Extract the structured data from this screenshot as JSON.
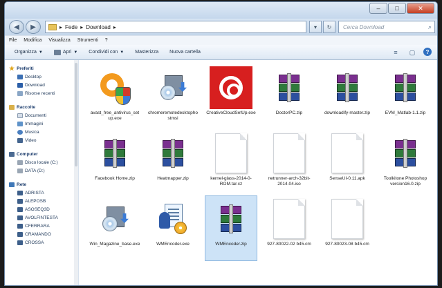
{
  "window": {
    "controls": {
      "minimize": "–",
      "maximize": "□",
      "close": "✕"
    }
  },
  "address": {
    "segments": [
      "Fede",
      "Download"
    ],
    "separators": [
      "▸",
      "▸",
      "▸"
    ],
    "back_icon": "◀",
    "forward_icon": "▶",
    "dropdown_icon": "▾",
    "refresh_icon": "↻",
    "search_placeholder": "Cerca Download",
    "search_icon": "magnifier"
  },
  "menu": [
    "File",
    "Modifica",
    "Visualizza",
    "Strumenti",
    "?"
  ],
  "toolbar": {
    "organize": "Organizza",
    "open": "Apri",
    "share": "Condividi con",
    "burn": "Masterizza",
    "new_folder": "Nuova cartella",
    "view_icon": "≡",
    "preview_icon": "▢",
    "help_icon": "?"
  },
  "sidebar": {
    "favorites_label": "Preferiti",
    "favorites": [
      "Desktop",
      "Download",
      "Risorse recenti"
    ],
    "libraries_label": "Raccolte",
    "libraries": [
      "Documenti",
      "Immagini",
      "Musica",
      "Video"
    ],
    "computer_label": "Computer",
    "drives": [
      "Disco locale (C:)",
      "DATA (D:)"
    ],
    "network_label": "Rete",
    "network": [
      "ADRISTA",
      "ALEPOSB",
      "ASOSEQ3D",
      "AVOLFINTESTA",
      "CFERRARA",
      "CRAMANDO",
      "CROSSA"
    ]
  },
  "files": [
    {
      "name": "avast_free_antivirus_setup.exe",
      "icon": "avast-icon"
    },
    {
      "name": "chromeremotedesktophostmsi",
      "icon": "setup-icon"
    },
    {
      "name": "CreativeCloudSetUp.exe",
      "icon": "creative-cloud-icon"
    },
    {
      "name": "DoctorPC.zip",
      "icon": "zip-archive-icon"
    },
    {
      "name": "downloadify-master.zip",
      "icon": "zip-archive-icon"
    },
    {
      "name": "EVM_Matlab-1.1.zip",
      "icon": "zip-archive-icon"
    },
    {
      "name": "Facebook Home.zip",
      "icon": "zip-archive-icon"
    },
    {
      "name": "Heatmapper.zip",
      "icon": "zip-archive-icon"
    },
    {
      "name": "kernel-glass-2014-0-ROM.tar.xz",
      "icon": "generic-file-icon"
    },
    {
      "name": "netrunner-arch-32bit-2014.04.iso",
      "icon": "generic-file-icon"
    },
    {
      "name": "SenseUI-0.11.apk",
      "icon": "generic-file-icon"
    },
    {
      "name": "Toolkitone Photoshop version16.0.zip",
      "icon": "zip-archive-icon"
    },
    {
      "name": "Win_Magazine_base.exe",
      "icon": "setup-icon"
    },
    {
      "name": "WMEncoder.exe",
      "icon": "movie-maker-icon"
    },
    {
      "name": "WMEncoder.zip",
      "icon": "zip-archive-icon",
      "selected": true
    },
    {
      "name": "927-80022-02 b45.cm",
      "icon": "generic-file-icon"
    },
    {
      "name": "927-80023-08 b45.cm",
      "icon": "generic-file-icon"
    }
  ]
}
